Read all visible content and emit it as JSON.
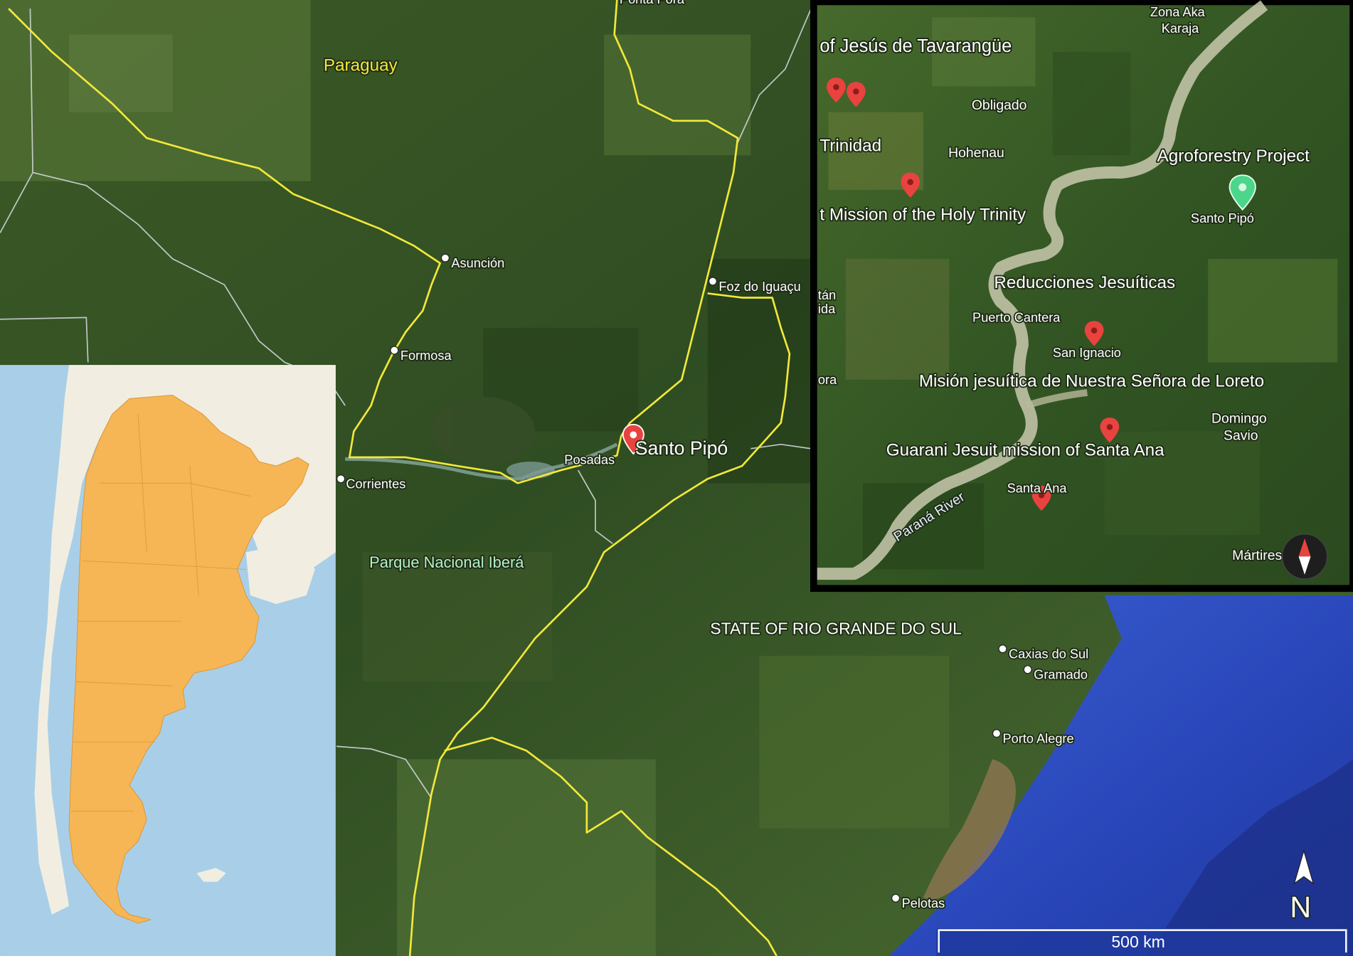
{
  "main_map": {
    "labels": {
      "country_paraguay": "Paraguay",
      "city_asuncion": "Asunción",
      "city_formosa": "Formosa",
      "city_corrientes": "Corrientes",
      "city_posadas": "Posadas",
      "city_foz": "Foz do Iguaçu",
      "city_partial_top": "Ponta Porã",
      "site_santo_pipo": "Santo Pipó",
      "park_ibera": "Parque Nacional Iberá",
      "state_rs": "STATE OF RIO GRANDE DO SUL",
      "city_caxias": "Caxias do Sul",
      "city_gramado": "Gramado",
      "city_porto_alegre": "Porto Alegre",
      "city_pelotas": "Pelotas"
    },
    "border_color": "#f2e83a",
    "marker_color": "#e9433f"
  },
  "inset_detail": {
    "labels": {
      "jesus_tavarangue": "of Jesús de Tavarangüe",
      "zona_aka": "Zona Aka",
      "karaja": "Karaja",
      "obligado": "Obligado",
      "trinidad": "Trinidad",
      "hohenau": "Hohenau",
      "agroforestry": "Agroforestry Project",
      "holy_trinity": "t Mission of the Holy Trinity",
      "santo_pipo": "Santo Pipó",
      "reducciones": "Reducciones Jesuíticas",
      "puerto_cantera": "Puerto Cantera",
      "san_ignacio": "San Ignacio",
      "loreto": "Misión jesuítica de Nuestra Señora de Loreto",
      "domingo": "Domingo",
      "savio": "Savio",
      "santa_ana_mission": "Guarani Jesuit mission of Santa Ana",
      "santa_ana": "Santa Ana",
      "parana_river": "Paraná River",
      "martires": "Mártires",
      "edge_tan": "tán",
      "edge_ida": "ida",
      "edge_ora": "ora"
    },
    "compass_icon": "compass-icon",
    "highlight_marker_color": "#4cd68a"
  },
  "inset_overview": {
    "country_fill": "#f6b655",
    "ocean": "#a9cfe8"
  },
  "north_arrow": {
    "label": "N"
  },
  "scale_bar": {
    "label": "500 km"
  }
}
